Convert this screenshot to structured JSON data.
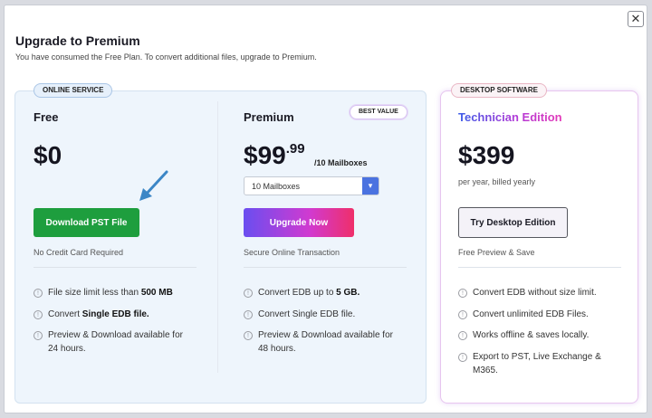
{
  "dialog": {
    "title": "Upgrade to Premium",
    "subtitle": "You have consumed the Free Plan. To convert additional files, upgrade to Premium.",
    "close_icon": "close-icon",
    "close_glyph": "✕"
  },
  "badges": {
    "online": "ONLINE SERVICE",
    "desktop": "DESKTOP SOFTWARE",
    "best": "BEST VALUE"
  },
  "plans": {
    "free": {
      "name": "Free",
      "price": "$0",
      "button": "Download PST File",
      "note": "No Credit Card Required",
      "features": [
        {
          "pre": "File size limit less than ",
          "bold": "500 MB",
          "post": ""
        },
        {
          "pre": "Convert ",
          "bold": "Single EDB file.",
          "post": ""
        },
        {
          "pre": "Preview & Download available for",
          "bold": "",
          "post": "24 hours."
        }
      ]
    },
    "premium": {
      "name": "Premium",
      "price_main": "$99",
      "price_cents": ".99",
      "price_unit": "/10 Mailboxes",
      "select_value": "10 Mailboxes",
      "button": "Upgrade Now",
      "note": "Secure Online Transaction",
      "features": [
        {
          "pre": "Convert EDB up to ",
          "bold": "5 GB.",
          "post": ""
        },
        {
          "pre": "Convert Single EDB file.",
          "bold": "",
          "post": ""
        },
        {
          "pre": "Preview & Download available for",
          "bold": "",
          "post": "48 hours."
        }
      ]
    },
    "desktop": {
      "name": "Technician Edition",
      "price": "$399",
      "billing": "per year, billed yearly",
      "button": "Try Desktop Edition",
      "note": "Free Preview & Save",
      "features": [
        {
          "pre": "Convert EDB without size limit.",
          "post": ""
        },
        {
          "pre": "Convert unlimited EDB Files.",
          "post": ""
        },
        {
          "pre": "Works offline & saves locally.",
          "post": ""
        },
        {
          "pre": "Export to PST, Live Exchange &",
          "post": "M365."
        }
      ]
    }
  },
  "icons": {
    "info": "info-icon",
    "info_glyph": "!",
    "chevron": "chevron-down-icon",
    "chevron_glyph": "▾",
    "arrow": "pointer-arrow-icon"
  },
  "colors": {
    "download_button": "#1e9e3e",
    "select_chevron": "#4a72e0",
    "upgrade_gradient": [
      "#6a4ef0",
      "#d13ad0",
      "#ef2f6a"
    ],
    "arrow": "#3b86c6"
  }
}
